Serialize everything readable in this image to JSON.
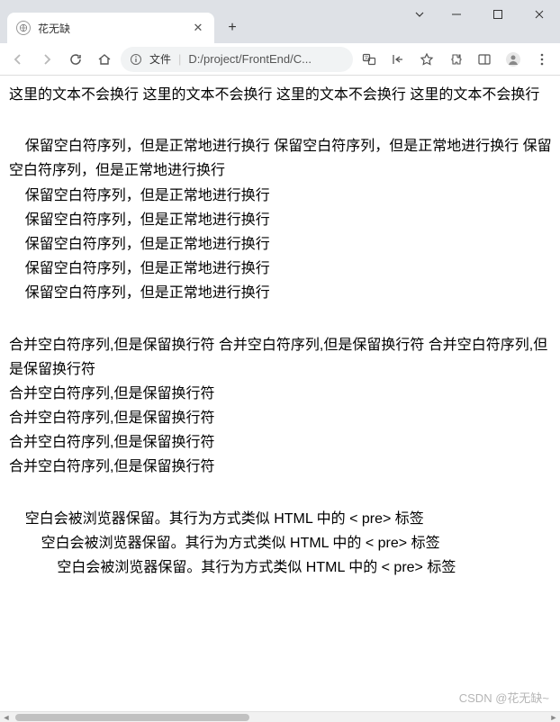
{
  "window": {
    "tab_title": "花无缺"
  },
  "toolbar": {
    "addr_chip": "文件",
    "addr_path": "D:/project/FrontEnd/C..."
  },
  "content": {
    "nowrap_text": "这里的文本不会换行 这里的文本不会换行 这里的文本不会换行 这里的文本不会换行",
    "prewrap_text": "    保留空白符序列，但是正常地进行换行 保留空白符序列，但是正常地进行换行 保留空白符序列，但是正常地进行换行\n    保留空白符序列，但是正常地进行换行\n    保留空白符序列，但是正常地进行换行\n    保留空白符序列，但是正常地进行换行\n    保留空白符序列，但是正常地进行换行\n    保留空白符序列，但是正常地进行换行",
    "preline_text": "合并空白符序列,但是保留换行符 合并空白符序列,但是保留换行符 合并空白符序列,但是保留换行符\n合并空白符序列,但是保留换行符\n合并空白符序列,但是保留换行符\n合并空白符序列,但是保留换行符\n合并空白符序列,但是保留换行符",
    "pre_text": "    空白会被浏览器保留。其行为方式类似 HTML 中的 < pre> 标签\n        空白会被浏览器保留。其行为方式类似 HTML 中的 < pre> 标签\n            空白会被浏览器保留。其行为方式类似 HTML 中的 < pre> 标签"
  },
  "watermark": "CSDN @花无缺~"
}
